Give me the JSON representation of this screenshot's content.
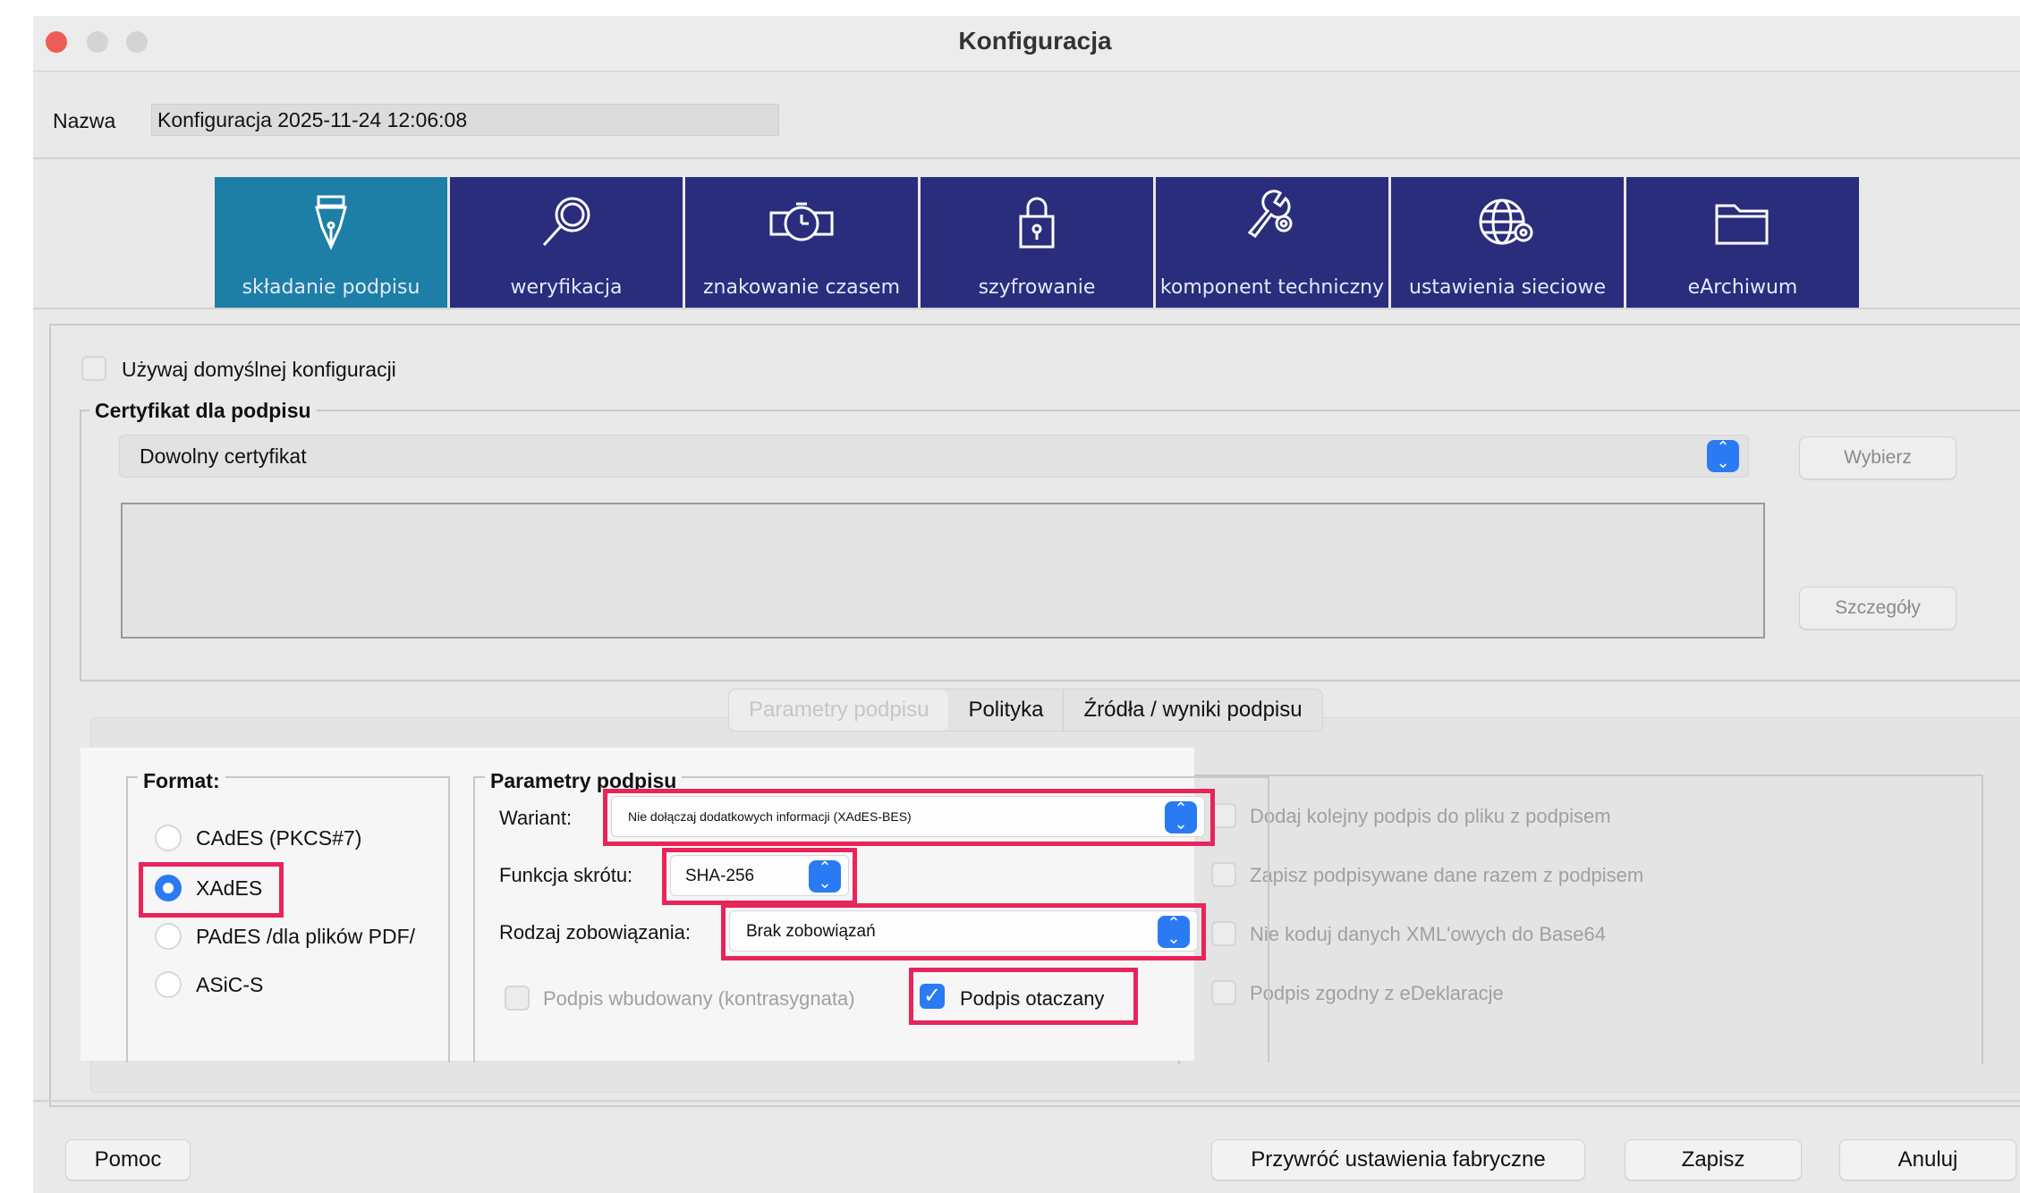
{
  "window": {
    "title": "Konfiguracja"
  },
  "name": {
    "label": "Nazwa",
    "value": "Konfiguracja 2025-11-24 12:06:08"
  },
  "tabs": [
    {
      "label": "składanie podpisu",
      "icon": "pen-nib-icon",
      "active": true
    },
    {
      "label": "weryfikacja",
      "icon": "magnifier-icon"
    },
    {
      "label": "znakowanie czasem",
      "icon": "clock-icon"
    },
    {
      "label": "szyfrowanie",
      "icon": "padlock-icon"
    },
    {
      "label": "komponent techniczny",
      "icon": "wrench-gear-icon"
    },
    {
      "label": "ustawienia sieciowe",
      "icon": "globe-gear-icon"
    },
    {
      "label": "eArchiwum",
      "icon": "folder-icon"
    }
  ],
  "use_default": {
    "label": "Używaj domyślnej konfiguracji",
    "checked": false
  },
  "certificate": {
    "legend": "Certyfikat dla podpisu",
    "selected": "Dowolny certyfikat",
    "choose_label": "Wybierz",
    "details_label": "Szczegóły"
  },
  "subtabs": [
    {
      "label": "Parametry podpisu",
      "selected": true
    },
    {
      "label": "Polityka"
    },
    {
      "label": "Źródła / wyniki podpisu"
    }
  ],
  "format": {
    "legend": "Format:",
    "options": [
      {
        "label": "CAdES (PKCS#7)",
        "selected": false
      },
      {
        "label": "XAdES",
        "selected": true
      },
      {
        "label": "PAdES /dla plików PDF/",
        "selected": false
      },
      {
        "label": "ASiC-S",
        "selected": false
      }
    ]
  },
  "params": {
    "legend": "Parametry podpisu",
    "variant_label": "Wariant:",
    "variant_value": "Nie dołączaj dodatkowych informacji (XAdES-BES)",
    "hash_label": "Funkcja skrótu:",
    "hash_value": "SHA-256",
    "commitment_label": "Rodzaj zobowiązania:",
    "commitment_value": "Brak zobowiązań",
    "embedded_label": "Podpis wbudowany (kontrasygnata)",
    "enveloping_label": "Podpis otaczany",
    "enveloping_checked": true
  },
  "options": [
    "Dodaj kolejny podpis do pliku z podpisem",
    "Zapisz podpisywane dane razem z podpisem",
    "Nie koduj danych XML'owych do Base64",
    "Podpis zgodny z eDeklaracje"
  ],
  "footer": {
    "help": "Pomoc",
    "restore": "Przywróć ustawienia fabryczne",
    "save": "Zapisz",
    "cancel": "Anuluj"
  },
  "colors": {
    "highlight": "#e8245a",
    "accent": "#2a7bf3",
    "tab": "#2a2c7c",
    "tab_active": "#1d7fa6"
  }
}
